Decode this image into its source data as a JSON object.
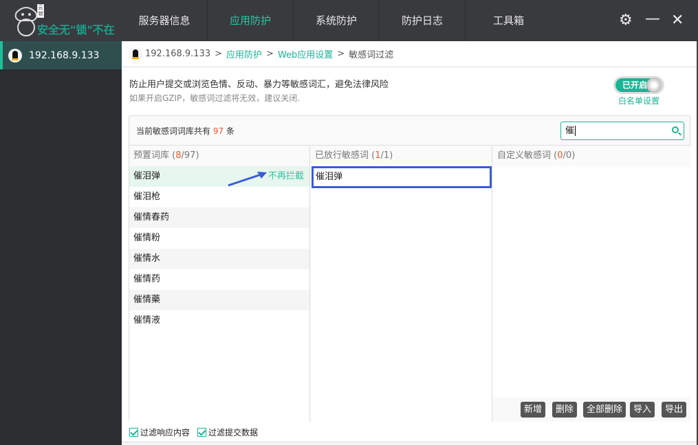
{
  "app": {
    "logo_text": "安全无\"锁\"不在",
    "logo_badge": "云锁"
  },
  "nav": {
    "tabs": [
      {
        "label": "服务器信息"
      },
      {
        "label": "应用防护",
        "active": true
      },
      {
        "label": "系统防护"
      },
      {
        "label": "防护日志"
      },
      {
        "label": "工具箱"
      }
    ]
  },
  "controls": {
    "settings_icon": "gear-icon",
    "minimize_icon": "minimize-icon",
    "close_icon": "close-icon"
  },
  "sidebar": {
    "items": [
      {
        "label": "192.168.9.133",
        "icon": "linux-penguin-icon"
      }
    ]
  },
  "breadcrumb": {
    "host": "192.168.9.133",
    "items": [
      "应用防护",
      "Web应用设置"
    ],
    "current": "敏感词过滤",
    "sep": ">"
  },
  "description": {
    "line1": "防止用户提交或浏览色情、反动、暴力等敏感词汇，避免法律风险",
    "line2": "如果开启GZIP，敏感词过滤将无效，建议关闭."
  },
  "toggle": {
    "label": "已开启",
    "on": true
  },
  "whitelist_link": "白名单设置",
  "summary": {
    "prefix": "当前敏感词词库共有",
    "count": "97",
    "suffix": "条"
  },
  "search": {
    "value": "催"
  },
  "columns": [
    {
      "title": "预置词库",
      "matched": "8",
      "total": "97",
      "rows": [
        "催泪弹",
        "催泪枪",
        "催情春药",
        "催情粉",
        "催情水",
        "催情药",
        "催情藥",
        "催情液"
      ],
      "row_action": "不再拦截"
    },
    {
      "title": "已放行敏感词",
      "matched": "1",
      "total": "1",
      "rows": [
        "催泪弹"
      ]
    },
    {
      "title": "自定义敏感词",
      "matched": "0",
      "total": "0",
      "rows": []
    }
  ],
  "buttons": {
    "add": "新增",
    "delete": "删除",
    "delete_all": "全部删除",
    "import": "导入",
    "export": "导出"
  },
  "checkboxes": [
    {
      "label": "过滤响应内容",
      "checked": true
    },
    {
      "label": "过滤提交数据",
      "checked": true
    }
  ],
  "colors": {
    "accent": "#1bb395",
    "highlight_count": "#f0572a",
    "selection_border": "#3a5bd9",
    "header_bg": "#393a3e"
  }
}
